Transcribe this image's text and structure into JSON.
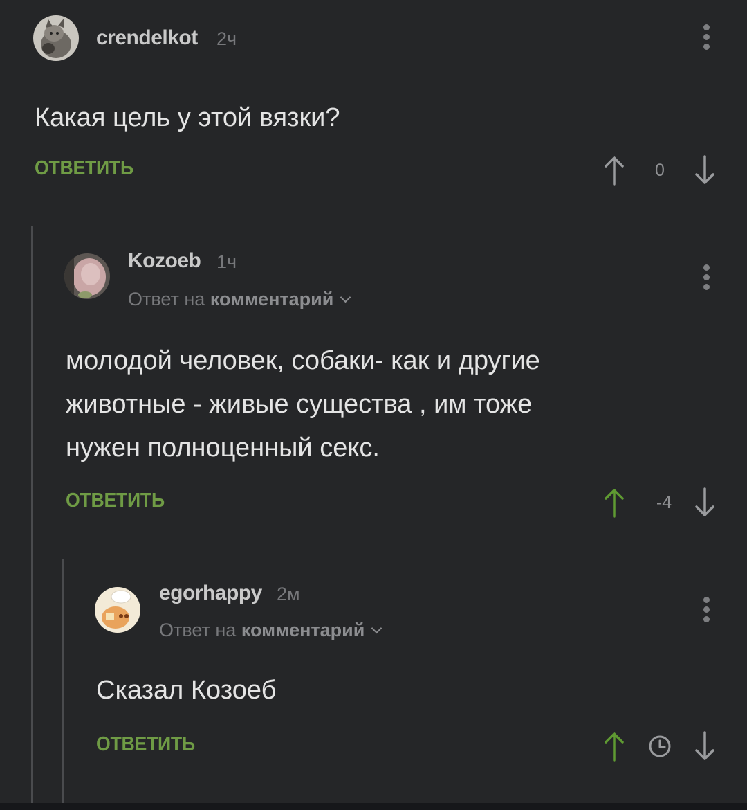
{
  "comments": [
    {
      "username": "crendelkot",
      "time": "2ч",
      "text": "Какая цель у этой вязки?",
      "reply_label": "ОТВЕТИТЬ",
      "score": "0"
    },
    {
      "username": "Kozoeb",
      "time": "1ч",
      "reply_prefix": "Ответ на",
      "reply_target": "комментарий",
      "text_lines": [
        "молодой человек, собаки- как и другие",
        "животные -  живые существа , им тоже",
        "нужен полноценный секс."
      ],
      "reply_label": "ОТВЕТИТЬ",
      "score": "-4"
    },
    {
      "username": "egorhappy",
      "time": "2м",
      "reply_prefix": "Ответ на",
      "reply_target": "комментарий",
      "text": "Сказал Козоеб",
      "reply_label": "ОТВЕТИТЬ",
      "score_icon": "clock-icon"
    }
  ],
  "colors": {
    "background": "#252628",
    "accent_green": "#6f9b45",
    "muted_text": "#77787b",
    "thread_line": "#4a4b4e"
  }
}
